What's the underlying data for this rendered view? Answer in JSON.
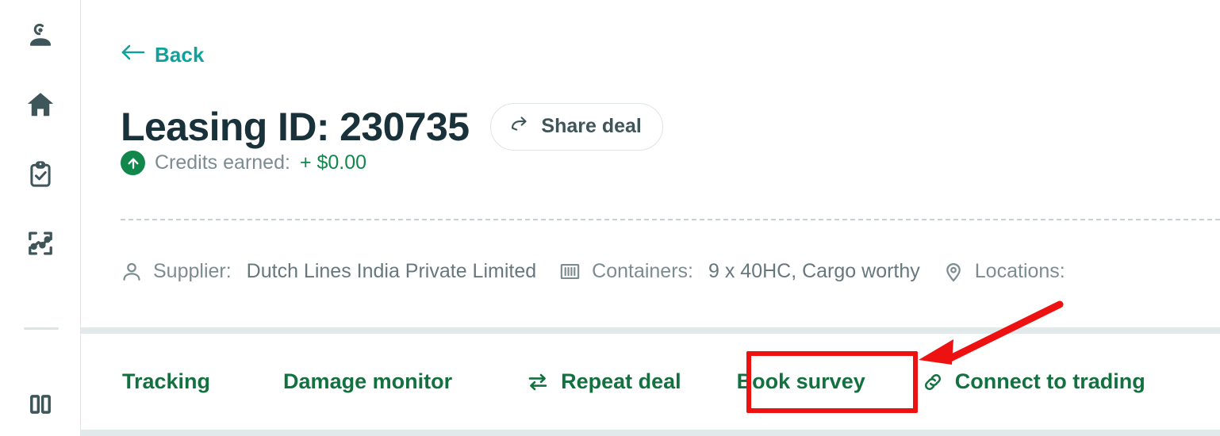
{
  "sidebar": {
    "items": [
      {
        "name": "account-icon",
        "label": "Account"
      },
      {
        "name": "home-icon",
        "label": "Home"
      },
      {
        "name": "clipboard-check-icon",
        "label": "Tasks"
      },
      {
        "name": "analytics-chart-icon",
        "label": "Analytics"
      }
    ],
    "collapse": {
      "name": "panel-toggle-icon",
      "label": "Collapse sidebar"
    }
  },
  "header": {
    "back_label": "Back",
    "back_icon": "arrow-left-icon",
    "title": "Leasing ID: 230735",
    "share_button": {
      "label": "Share deal",
      "icon": "share-arrow-icon"
    },
    "credits": {
      "icon": "arrow-up-circle-icon",
      "label": "Credits earned:",
      "value": "+ $0.00"
    }
  },
  "meta": [
    {
      "icon": "person-icon",
      "label": "Supplier:",
      "value": "Dutch Lines India Private Limited"
    },
    {
      "icon": "container-icon",
      "label": "Containers:",
      "value": "9 x 40HC, Cargo worthy"
    },
    {
      "icon": "location-pin-icon",
      "label": "Locations:",
      "value": ""
    }
  ],
  "actions": [
    {
      "label": "Tracking",
      "icon": ""
    },
    {
      "label": "Damage monitor",
      "icon": ""
    },
    {
      "label": "Repeat deal",
      "icon": "swap-arrows-icon"
    },
    {
      "label": "Book survey",
      "icon": ""
    },
    {
      "label": "Connect to trading",
      "icon": "link-chain-icon"
    }
  ],
  "colors": {
    "teal_link": "#12a19a",
    "title_dark": "#19313a",
    "green_action": "#12713f",
    "green_credit": "#12874c",
    "muted_text": "#7d8c91",
    "sidebar_icon": "#3e5559",
    "annotation_red": "#ee1111",
    "divider": "#dde4e6"
  },
  "annotations": {
    "highlight_target": "Book survey",
    "arrow": "red-arrow-pointing-to-book-survey"
  }
}
